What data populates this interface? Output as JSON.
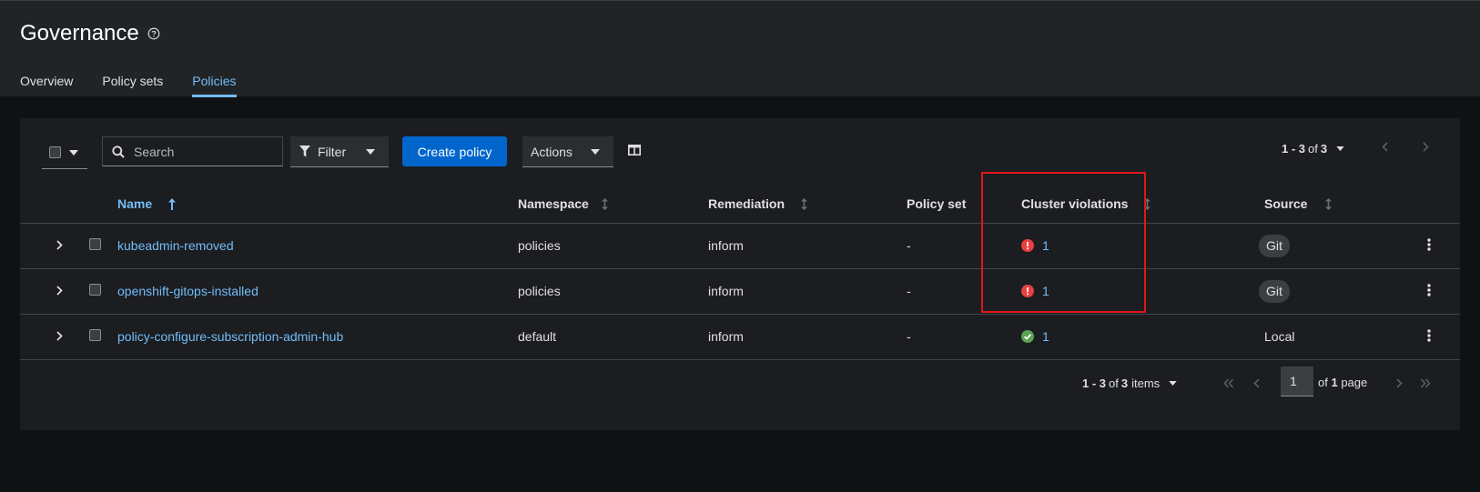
{
  "header": {
    "title": "Governance",
    "tabs": [
      {
        "label": "Overview",
        "active": false
      },
      {
        "label": "Policy sets",
        "active": false
      },
      {
        "label": "Policies",
        "active": true
      }
    ]
  },
  "toolbar": {
    "search_placeholder": "Search",
    "filter_label": "Filter",
    "create_label": "Create policy",
    "actions_label": "Actions",
    "pagination": {
      "range": "1 - 3",
      "of": "of",
      "total": "3"
    }
  },
  "table": {
    "columns": [
      "Name",
      "Namespace",
      "Remediation",
      "Policy set",
      "Cluster violations",
      "Source"
    ],
    "rows": [
      {
        "name": "kubeadmin-removed",
        "namespace": "policies",
        "remediation": "inform",
        "policy_set": "-",
        "violations": "1",
        "violation_status": "error",
        "source": "Git",
        "source_badge": true
      },
      {
        "name": "openshift-gitops-installed",
        "namespace": "policies",
        "remediation": "inform",
        "policy_set": "-",
        "violations": "1",
        "violation_status": "error",
        "source": "Git",
        "source_badge": true
      },
      {
        "name": "policy-configure-subscription-admin-hub",
        "namespace": "default",
        "remediation": "inform",
        "policy_set": "-",
        "violations": "1",
        "violation_status": "success",
        "source": "Local",
        "source_badge": false
      }
    ]
  },
  "footer": {
    "range": "1 - 3",
    "of": "of",
    "total": "3",
    "items_label": "items",
    "page_value": "1",
    "of_page_prefix": "of",
    "page_count": "1",
    "page_label": "page"
  },
  "colors": {
    "accent": "#73bcf7",
    "primary_button": "#0066cc",
    "error": "#e9403e",
    "success": "#3e8635",
    "highlight_box": "#e0161a"
  }
}
